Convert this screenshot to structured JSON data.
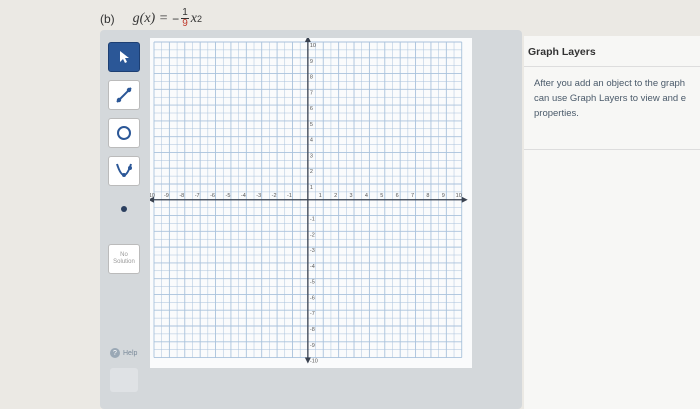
{
  "problem": {
    "part": "(b)",
    "function_lhs": "g(x) =",
    "minus": "−",
    "frac_num": "1",
    "frac_den": "9",
    "var": "x",
    "exponent": "2"
  },
  "toolbar": {
    "tools": [
      {
        "name": "pointer-tool",
        "icon": "arrow-cursor-icon"
      },
      {
        "name": "line-tool",
        "icon": "line-segment-icon"
      },
      {
        "name": "circle-tool",
        "icon": "circle-icon"
      },
      {
        "name": "parabola-tool",
        "icon": "parabola-icon"
      },
      {
        "name": "point-tool",
        "icon": "point-icon"
      }
    ],
    "no_solution_label_1": "No",
    "no_solution_label_2": "Solution",
    "help_label": "Help"
  },
  "graph": {
    "x_ticks": [
      "-10",
      "-9",
      "-8",
      "-7",
      "-6",
      "-5",
      "-4",
      "-3",
      "-2",
      "-1",
      "1",
      "2",
      "3",
      "4",
      "5",
      "6",
      "7",
      "8",
      "9",
      "10"
    ],
    "y_ticks": [
      "10",
      "9",
      "8",
      "7",
      "6",
      "5",
      "4",
      "3",
      "2",
      "1",
      "-1",
      "-2",
      "-3",
      "-4",
      "-5",
      "-6",
      "-7",
      "-8",
      "-9",
      "-10"
    ],
    "xlim": [
      -10,
      10
    ],
    "ylim": [
      -10,
      10
    ],
    "grid": true,
    "colors": {
      "grid": "#a9c2dc",
      "axis": "#3a4250",
      "accent": "#2b5797"
    }
  },
  "layers": {
    "title": "Graph Layers",
    "desc_line1": "After you add an object to the graph",
    "desc_line2": "can use Graph Layers to view and e",
    "desc_line3": "properties."
  }
}
